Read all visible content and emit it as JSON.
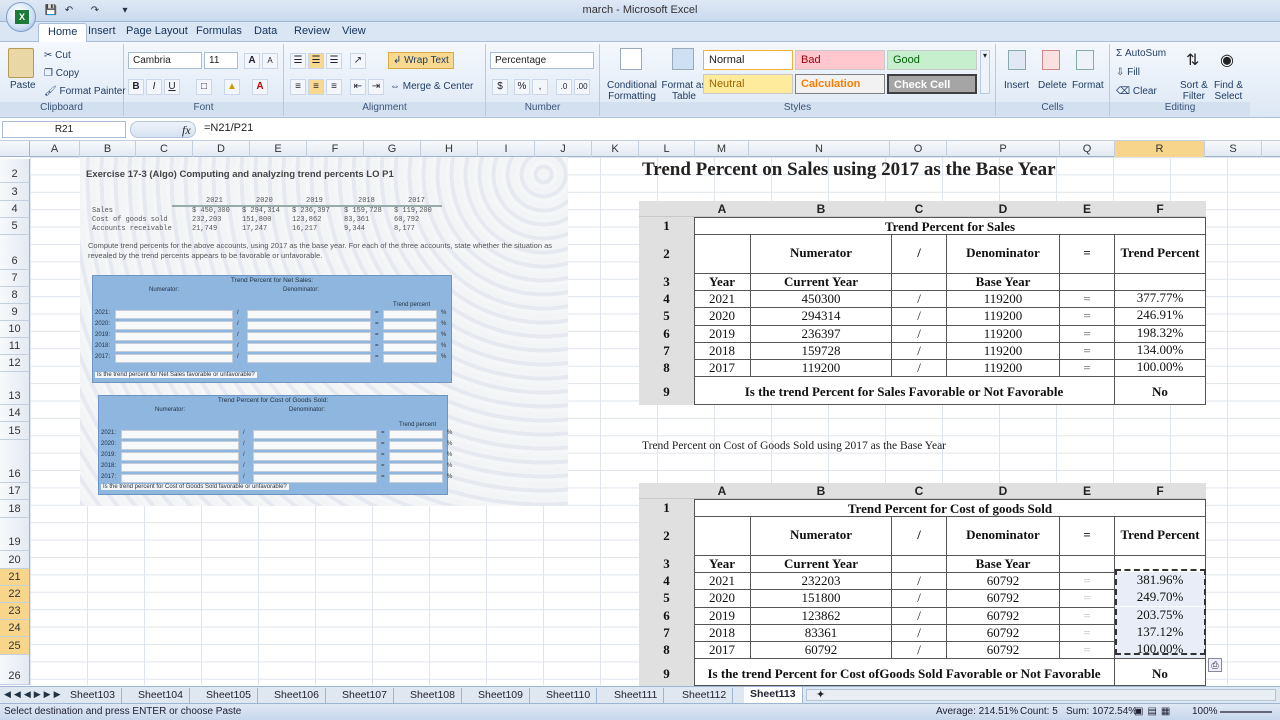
{
  "window": {
    "title": "march - Microsoft Excel"
  },
  "tabs": [
    {
      "label": "Home",
      "active": true
    },
    {
      "label": "Insert"
    },
    {
      "label": "Page Layout"
    },
    {
      "label": "Formulas"
    },
    {
      "label": "Data"
    },
    {
      "label": "Review"
    },
    {
      "label": "View"
    }
  ],
  "ribbon": {
    "clipboard": {
      "paste": "Paste",
      "cut": "Cut",
      "copy": "Copy",
      "format_painter": "Format Painter",
      "label": "Clipboard"
    },
    "font": {
      "name": "Cambria",
      "size": "11",
      "label": "Font",
      "bold": "B",
      "italic": "I",
      "underline": "U",
      "grow": "A",
      "shrink": "A"
    },
    "alignment": {
      "wrap": "Wrap Text",
      "merge": "Merge & Center",
      "label": "Alignment"
    },
    "number": {
      "format": "Percentage",
      "label": "Number",
      "currency": "$",
      "percent": "%",
      "comma": ","
    },
    "styles": {
      "conditional": "Conditional",
      "conditional2": "Formatting",
      "format_table": "Format as",
      "format_table2": "Table",
      "normal": "Normal",
      "bad": "Bad",
      "good": "Good",
      "neutral": "Neutral",
      "calculation": "Calculation",
      "check_cell": "Check Cell",
      "label": "Styles"
    },
    "cells": {
      "insert": "Insert",
      "delete": "Delete",
      "format": "Format",
      "label": "Cells"
    },
    "editing": {
      "autosum": "AutoSum",
      "fill": "Fill",
      "clear": "Clear",
      "sort": "Sort &",
      "sort2": "Filter",
      "find": "Find &",
      "find2": "Select",
      "label": "Editing"
    }
  },
  "formula_bar": {
    "name_box": "R21",
    "fx": "fx",
    "formula": "=N21/P21"
  },
  "columns": [
    "A",
    "B",
    "C",
    "D",
    "E",
    "F",
    "G",
    "H",
    "I",
    "J",
    "K",
    "L",
    "M",
    "N",
    "O",
    "P",
    "Q",
    "R",
    "S"
  ],
  "rows": [
    "2",
    "3",
    "4",
    "5",
    "6",
    "7",
    "8",
    "9",
    "10",
    "11",
    "12",
    "13",
    "14",
    "15",
    "16",
    "17",
    "18",
    "19",
    "20",
    "21",
    "22",
    "23",
    "24",
    "25",
    "26"
  ],
  "photo": {
    "title": "Exercise 17-3 (Algo) Computing and analyzing trend percents LO P1",
    "years": [
      "2021",
      "2020",
      "2019",
      "2018",
      "2017"
    ],
    "sales_label": "Sales",
    "sales": [
      "$ 450,300",
      "$ 294,314",
      "$ 236,397",
      "$ 159,728",
      "$ 119,200"
    ],
    "cogs_label": "Cost of goods sold",
    "cogs": [
      "232,203",
      "151,800",
      "123,862",
      "83,361",
      "60,792"
    ],
    "ar_label": "Accounts receivable",
    "ar": [
      "21,749",
      "17,247",
      "16,217",
      "9,344",
      "8,177"
    ],
    "instructions": "Compute trend percents for the above accounts, using 2017 as the base year. For each of the three accounts, state whether the situation as revealed by the trend percents appears to be favorable or unfavorable.",
    "form1_title": "Trend Percent for Net Sales:",
    "form1_q": "Is the trend percent for Net Sales favorable or unfavorable?",
    "form2_title": "Trend Percent for Cost of Goods Sold:",
    "form2_q": "Is the trend percent for Cost of Goods Sold favorable or unfavorable?",
    "numerator": "Numerator:",
    "denominator": "Denominator:",
    "trend_percent": "Trend percent",
    "slash": "/",
    "equals": "=",
    "pct": "%",
    "form_years": [
      "2021:",
      "2020:",
      "2019:",
      "2018:",
      "2017:"
    ]
  },
  "sales_table": {
    "heading": "Trend Percent on Sales using 2017 as the Base Year",
    "col_letters": [
      "A",
      "B",
      "C",
      "D",
      "E",
      "F"
    ],
    "title": "Trend Percent for Sales",
    "row_numbers": [
      "1",
      "2",
      "3",
      "4",
      "5",
      "6",
      "7",
      "8",
      "9"
    ],
    "numerator": "Numerator",
    "slash": "/",
    "denominator": "Denominator",
    "equals": "=",
    "trend_percent": "Trend Percent",
    "year": "Year",
    "current_year": "Current Year",
    "base_year": "Base Year",
    "rows": [
      {
        "year": "2021",
        "current": "450300",
        "base": "119200",
        "pct": "377.77%"
      },
      {
        "year": "2020",
        "current": "294314",
        "base": "119200",
        "pct": "246.91%"
      },
      {
        "year": "2019",
        "current": "236397",
        "base": "119200",
        "pct": "198.32%"
      },
      {
        "year": "2018",
        "current": "159728",
        "base": "119200",
        "pct": "134.00%"
      },
      {
        "year": "2017",
        "current": "119200",
        "base": "119200",
        "pct": "100.00%"
      }
    ],
    "question": "Is the trend Percent for Sales Favorable or Not Favorable",
    "answer": "No"
  },
  "cogs_table": {
    "heading": "Trend Percent on Cost of Goods Sold using 2017 as the Base Year",
    "col_letters": [
      "A",
      "B",
      "C",
      "D",
      "E",
      "F"
    ],
    "title": "Trend Percent for Cost of goods Sold",
    "row_numbers": [
      "1",
      "2",
      "3",
      "4",
      "5",
      "6",
      "7",
      "8",
      "9"
    ],
    "numerator": "Numerator",
    "slash": "/",
    "denominator": "Denominator",
    "equals": "=",
    "trend_percent": "Trend Percent",
    "year": "Year",
    "current_year": "Current Year",
    "base_year": "Base Year",
    "rows": [
      {
        "year": "2021",
        "current": "232203",
        "base": "60792",
        "pct": "381.96%"
      },
      {
        "year": "2020",
        "current": "151800",
        "base": "60792",
        "pct": "249.70%"
      },
      {
        "year": "2019",
        "current": "123862",
        "base": "60792",
        "pct": "203.75%"
      },
      {
        "year": "2018",
        "current": "83361",
        "base": "60792",
        "pct": "137.12%"
      },
      {
        "year": "2017",
        "current": "60792",
        "base": "60792",
        "pct": "100.00%"
      }
    ],
    "question": "Is the trend Percent for Cost ofGoods Sold Favorable or Not Favorable",
    "answer": "No"
  },
  "sheet_tabs": [
    "Sheet103",
    "Sheet104",
    "Sheet105",
    "Sheet106",
    "Sheet107",
    "Sheet108",
    "Sheet109",
    "Sheet110",
    "Sheet111",
    "Sheet112",
    "Sheet113"
  ],
  "active_sheet": "Sheet113",
  "status": {
    "message": "Select destination and press ENTER or choose Paste",
    "average": "Average: 214.51%",
    "count": "Count: 5",
    "sum": "Sum: 1072.54%",
    "zoom": "100%"
  }
}
